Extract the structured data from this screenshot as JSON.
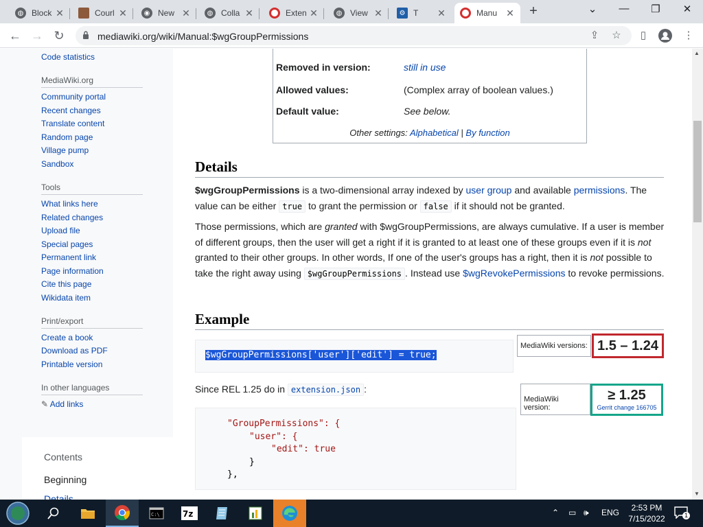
{
  "browser": {
    "tabs": [
      {
        "title": "Block",
        "icon": "globe-icon"
      },
      {
        "title": "Courl",
        "icon": "avatar-icon"
      },
      {
        "title": "New",
        "icon": "chrome-icon"
      },
      {
        "title": "Colla",
        "icon": "globe-icon"
      },
      {
        "title": "Exten",
        "icon": "opera-icon"
      },
      {
        "title": "View",
        "icon": "globe-icon"
      },
      {
        "title": "T",
        "icon": "tool-icon"
      },
      {
        "title": "Manu",
        "icon": "opera-icon"
      }
    ],
    "url": "mediawiki.org/wiki/Manual:$wgGroupPermissions"
  },
  "sidebar": {
    "top_link": "Code statistics",
    "sections": [
      {
        "heading": "MediaWiki.org",
        "items": [
          "Community portal",
          "Recent changes",
          "Translate content",
          "Random page",
          "Village pump",
          "Sandbox"
        ]
      },
      {
        "heading": "Tools",
        "items": [
          "What links here",
          "Related changes",
          "Upload file",
          "Special pages",
          "Permanent link",
          "Page information",
          "Cite this page",
          "Wikidata item"
        ]
      },
      {
        "heading": "Print/export",
        "items": [
          "Create a book",
          "Download as PDF",
          "Printable version"
        ]
      },
      {
        "heading": "In other languages",
        "items": [
          "Add links"
        ]
      }
    ],
    "contents": {
      "title": "Contents",
      "items": [
        "Beginning",
        "Details"
      ]
    }
  },
  "infobox": {
    "removed_label": "Removed in version:",
    "removed_value": "still in use",
    "allowed_label": "Allowed values:",
    "allowed_value": "(Complex array of boolean values.)",
    "default_label": "Default value:",
    "default_value": "See below.",
    "other_prefix": "Other settings:",
    "other_alpha": "Alphabetical",
    "other_sep": "|",
    "other_func": "By function"
  },
  "details": {
    "heading": "Details",
    "p1": {
      "bold": "$wgGroupPermissions",
      "t1": " is a two-dimensional array indexed by ",
      "link1": "user group",
      "t2": " and available ",
      "link2": "permissions",
      "t3": ". The value can be either ",
      "code1": "true",
      "t4": " to grant the permission or ",
      "code2": "false",
      "t5": " if it should not be granted."
    },
    "p2": {
      "t1": "Those permissions, which are ",
      "em1": "granted",
      "t2": " with $wgGroupPermissions, are always cumulative. If a user is member of different groups, then the user will get a right if it is granted to at least one of these groups even if it is ",
      "em2": "not",
      "t3": " granted to their other groups. In other words, If one of the user's groups has a right, then it is ",
      "em3": "not",
      "t4": " possible to take the right away using ",
      "code1": "$wgGroupPermissions",
      "t5": ". Instead use ",
      "link1": "$wgRevokePermissions",
      "t6": " to revoke permissions."
    }
  },
  "example": {
    "heading": "Example",
    "code1": "$wgGroupPermissions['user']['edit'] = true;",
    "versions_label1": "MediaWiki versions:",
    "versions_value1": "1.5 – 1.24",
    "since_text": "Since REL 1.25 do in ",
    "since_code": "extension.json",
    "since_after": ":",
    "versions_label2": "MediaWiki version:",
    "versions_value2": "≥ 1.25",
    "gerrit": "Gerrit change 166705",
    "json_lines": [
      "\"GroupPermissions\": {",
      "\"user\": {",
      "\"edit\": true",
      "}",
      "},"
    ]
  },
  "taskbar": {
    "lang": "ENG",
    "time": "2:53 PM",
    "date": "7/15/2022",
    "notif_count": "1"
  },
  "colors": {
    "accent_red": "#c0272d",
    "accent_green": "#14a58a",
    "link": "#0645ad"
  }
}
